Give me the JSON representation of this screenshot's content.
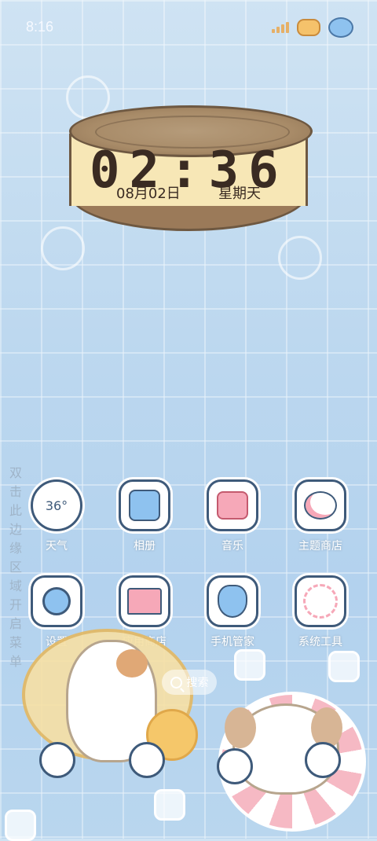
{
  "status_bar": {
    "time": "8:16"
  },
  "clock_widget": {
    "time": "02:36",
    "date": "08月02日",
    "weekday": "星期天"
  },
  "side_hint": "双击此边缘区域开启菜单",
  "apps": [
    {
      "label": "天气",
      "icon": "weather-icon",
      "badge": "36°"
    },
    {
      "label": "相册",
      "icon": "gallery-icon"
    },
    {
      "label": "音乐",
      "icon": "music-icon"
    },
    {
      "label": "主题商店",
      "icon": "theme-store-icon"
    },
    {
      "label": "设置",
      "icon": "settings-icon"
    },
    {
      "label": "应用商店",
      "icon": "app-store-icon"
    },
    {
      "label": "手机管家",
      "icon": "phone-manager-icon"
    },
    {
      "label": "系统工具",
      "icon": "system-tools-icon"
    }
  ],
  "search": {
    "label": "搜索"
  },
  "colors": {
    "label_white": "#ffffff",
    "icon_outline": "#3e5a7a",
    "accent_pink": "#f6a8b8",
    "accent_blue": "#8ec2ef"
  }
}
